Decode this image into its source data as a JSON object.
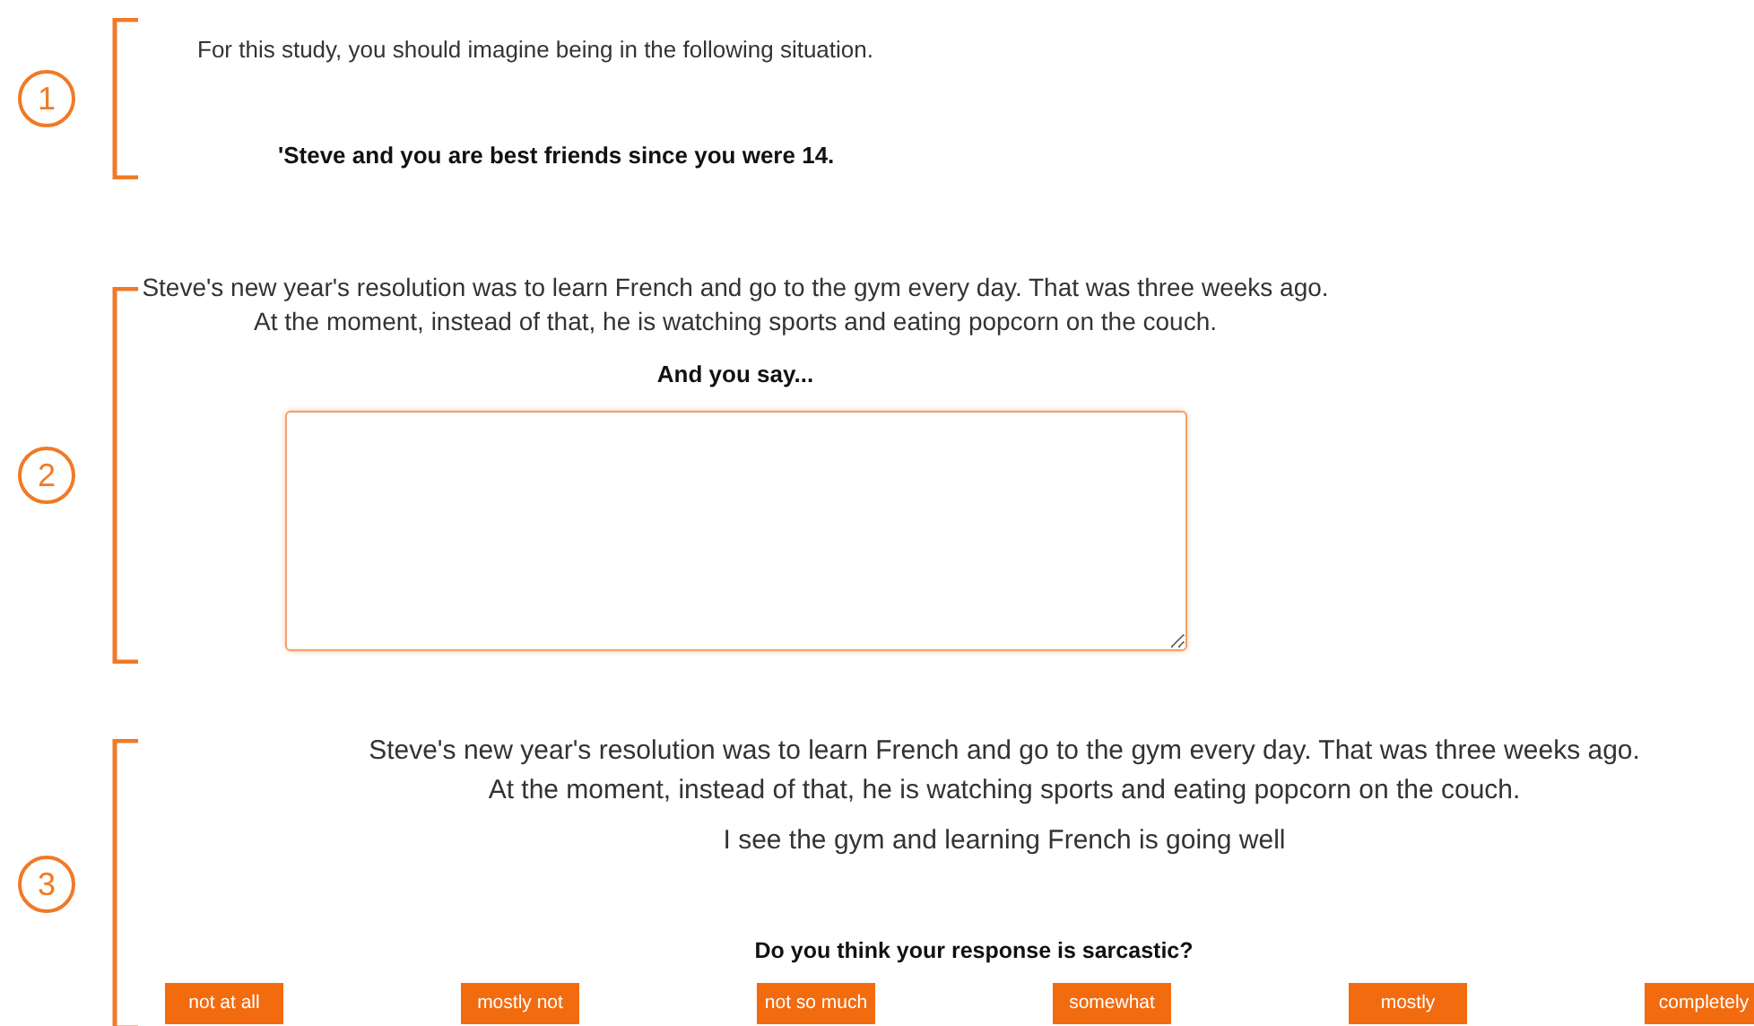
{
  "sections": [
    {
      "step": "1",
      "intro": "For this study, you should imagine being in the following situation.",
      "statement": "'Steve and you are best friends since you were 14."
    },
    {
      "step": "2",
      "context": [
        "Steve's new year's resolution was to learn French and go to the gym every day. That was three weeks ago.",
        "At the moment, instead of that, he is watching sports and eating popcorn on the couch."
      ],
      "prompt": "And you say..."
    },
    {
      "step": "3",
      "context": [
        "Steve's new year's resolution was to learn French and go to the gym every day. That was three weeks ago.",
        "At the moment, instead of that, he is watching sports and eating popcorn on the couch."
      ],
      "response": "I see the gym and learning French is going well",
      "question": "Do you think your response is sarcastic?",
      "options": [
        "not at all",
        "mostly not",
        "not so much",
        "somewhat",
        "mostly",
        "completely"
      ]
    }
  ]
}
